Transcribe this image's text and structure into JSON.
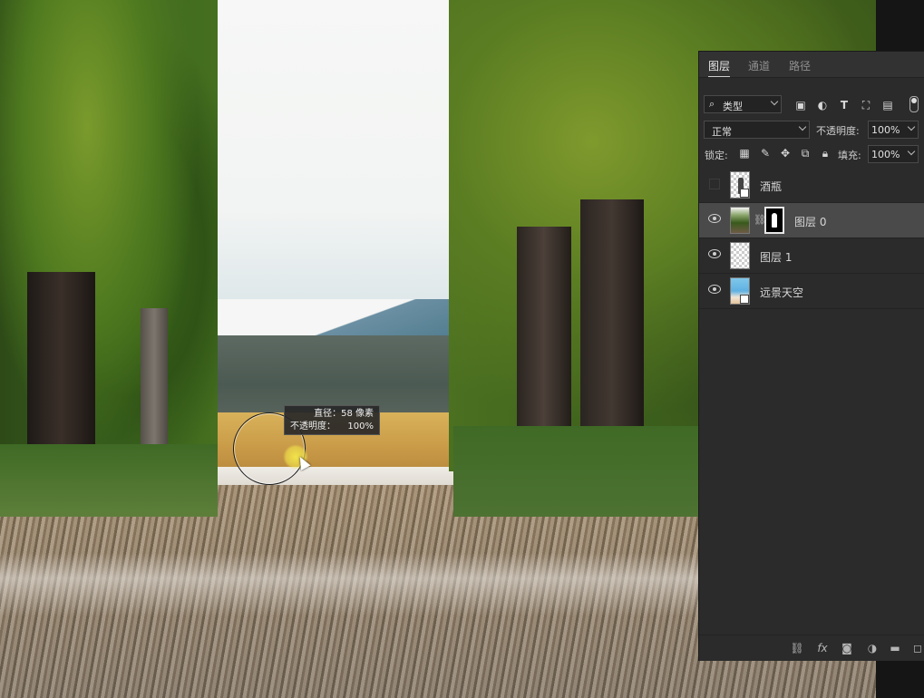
{
  "tooltip": {
    "diameter_label": "直径：",
    "diameter_value": "58 像素",
    "opacity_label": "不透明度：",
    "opacity_value": "100%"
  },
  "panel": {
    "tabs": [
      {
        "label": "图层",
        "active": true
      },
      {
        "label": "通道",
        "active": false
      },
      {
        "label": "路径",
        "active": false
      }
    ],
    "filter_kind": "类型",
    "blend_mode": "正常",
    "opacity_label": "不透明度:",
    "opacity_value": "100%",
    "lock_label": "锁定:",
    "fill_label": "填充:",
    "fill_value": "100%",
    "layers": [
      {
        "name": "酒瓶",
        "visible": false,
        "selected": false,
        "thumb": "bottle",
        "smart_object": true
      },
      {
        "name": "图层 0",
        "visible": true,
        "selected": true,
        "thumb": "photo",
        "has_mask": true,
        "linked": true
      },
      {
        "name": "图层 1",
        "visible": true,
        "selected": false,
        "thumb": "transparent"
      },
      {
        "name": "远景天空",
        "visible": true,
        "selected": false,
        "thumb": "sky",
        "smart_object": true
      }
    ],
    "footer_icons": [
      "link-icon",
      "fx-icon",
      "add-mask-icon",
      "adjustment-icon",
      "folder-icon",
      "new-layer-icon"
    ]
  }
}
